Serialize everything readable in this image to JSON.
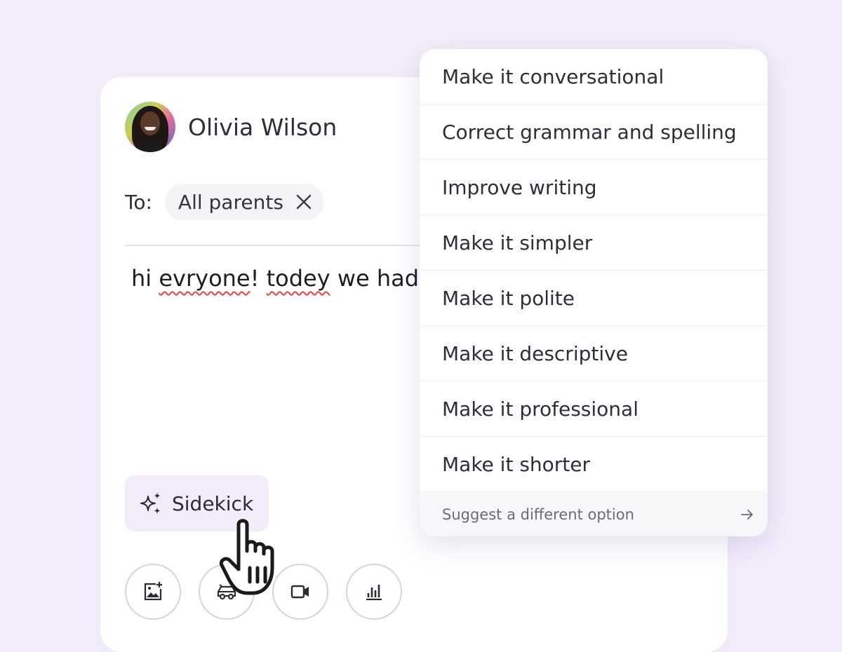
{
  "compose": {
    "sender_name": "Olivia Wilson",
    "to_label": "To:",
    "recipient_chip": "All parents",
    "message": {
      "words": [
        {
          "text": "hi ",
          "misspelled": false
        },
        {
          "text": "evryone",
          "misspelled": true
        },
        {
          "text": "! ",
          "misspelled": false
        },
        {
          "text": "todey",
          "misspelled": true
        },
        {
          "text": " we had",
          "misspelled": false
        }
      ]
    },
    "sidekick_label": "Sidekick",
    "toolbar": {
      "buttons": [
        {
          "name": "add-image-button",
          "icon": "image-add-icon"
        },
        {
          "name": "field-trip-button",
          "icon": "bus-icon"
        },
        {
          "name": "video-button",
          "icon": "video-camera-icon"
        },
        {
          "name": "poll-button",
          "icon": "bar-chart-icon"
        }
      ]
    }
  },
  "sidekick_menu": {
    "items": [
      "Make it conversational",
      "Correct grammar and spelling",
      "Improve writing",
      "Make it simpler",
      "Make it polite",
      "Make it descriptive",
      "Make it professional",
      "Make it shorter"
    ],
    "footer_label": "Suggest a different option",
    "footer_icon": "arrow-right-icon"
  },
  "colors": {
    "page_background": "#f3edfb",
    "sidekick_background": "#f1ebfa",
    "spellcheck_underline": "#e2453c"
  }
}
